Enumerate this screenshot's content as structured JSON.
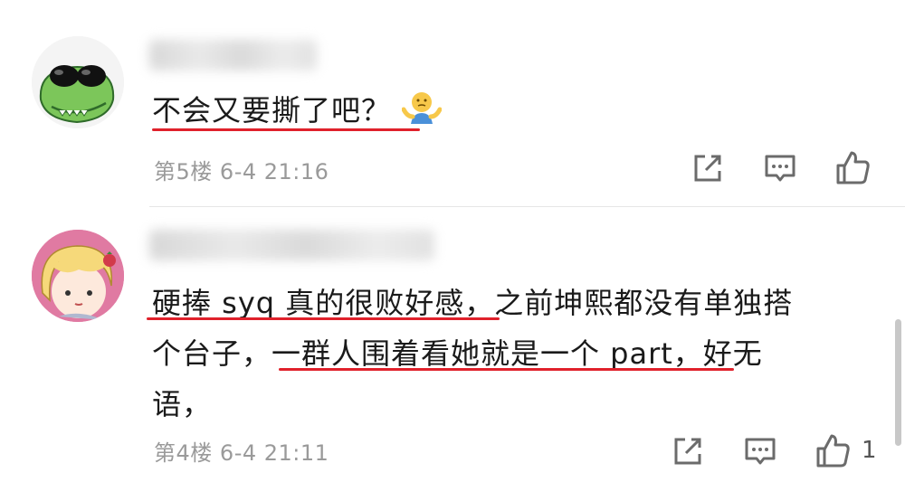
{
  "comments": [
    {
      "text_lines": [
        "不会又要撕了吧？"
      ],
      "emoji_icon": "shrug-emoji-icon",
      "floor": "第5楼",
      "date": "6-4",
      "time": "21:16",
      "likes": ""
    },
    {
      "text_lines": [
        "硬捧 syq 真的很败好感，之前坤熙都没有单独搭",
        "个台子，一群人围着看她就是一个 part，好无",
        "语，"
      ],
      "floor": "第4楼",
      "date": "6-4",
      "time": "21:11",
      "likes": "1"
    }
  ],
  "actions": [
    "share-icon",
    "reply-icon",
    "like-icon"
  ],
  "colors": {
    "highlight_underline": "#e0212b",
    "meta_text": "#9a9a9a",
    "icon_stroke": "#6b6b6b"
  }
}
